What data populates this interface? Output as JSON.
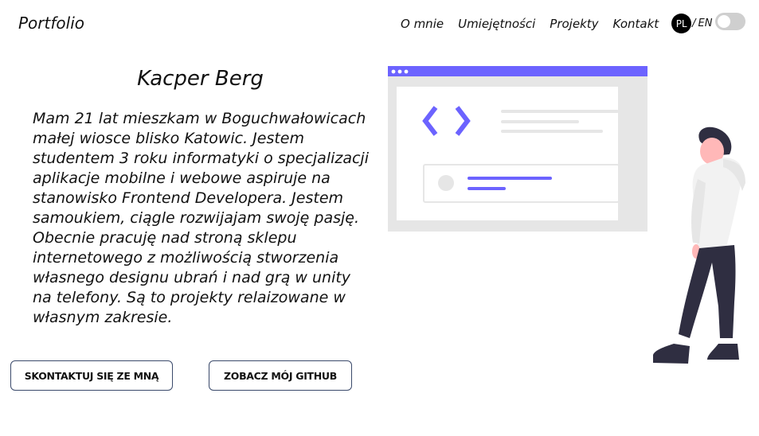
{
  "header": {
    "logo": "Portfolio",
    "nav": [
      "O mnie",
      "Umiejętności",
      "Projekty",
      "Kontakt"
    ],
    "lang_active": "PL",
    "lang_sep": "/",
    "lang_other": "EN"
  },
  "hero": {
    "name": "Kacper Berg",
    "bio": "Mam 21 lat mieszkam w Boguchwałowicach małej wiosce blisko Katowic. Jestem studentem 3 roku informatyki o specjalizacji aplikacje mobilne i webowe aspiruje na stanowisko Frontend Developera. Jestem samoukiem, ciągle rozwijajam swoję pasję. Obecnie pracuję nad stroną sklepu internetowego z możliwością stworzenia własnego designu ubrań i nad grą w unity na telefony. Są to projekty relaizowane w własnym zakresie.",
    "contact_button": "SKONTAKTUJ SIĘ ZE MNĄ",
    "github_button": "ZOBACZ MÓJ GITHUB"
  },
  "colors": {
    "accent": "#6c63ff",
    "skin": "#ffb8b8",
    "pants": "#2f2e41"
  },
  "icons": {
    "toggle": "theme-toggle",
    "code": "code-brackets-icon"
  }
}
